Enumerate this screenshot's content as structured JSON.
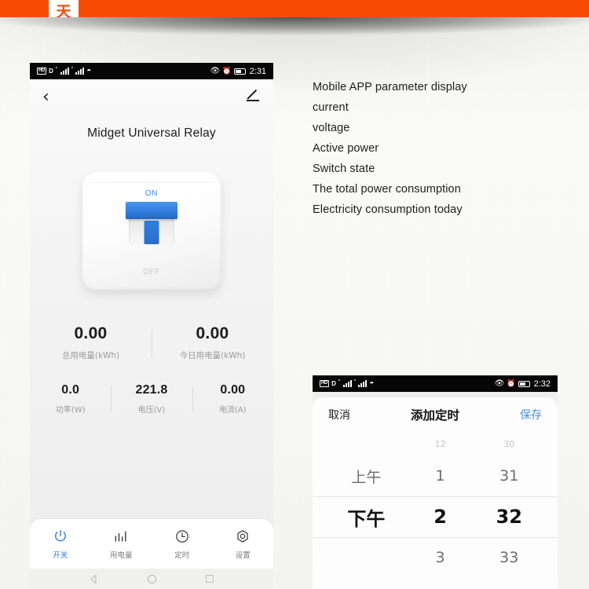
{
  "banner": {
    "logo_glyph": "天",
    "color": "#fa4b05"
  },
  "phone_one": {
    "status_bar": {
      "hd_label": "HD",
      "data_label": "D",
      "time": "2:31"
    },
    "nav": {
      "back_icon": "chevron-left-icon",
      "edit_icon": "pencil-icon"
    },
    "title": "Midget Universal Relay",
    "device": {
      "on_label": "ON",
      "off_label": "OFF",
      "switch_state": "on",
      "switch_color": "#2f7fe0"
    },
    "stats_primary": [
      {
        "value": "0.00",
        "label": "总用电量(kWh)"
      },
      {
        "value": "0.00",
        "label": "今日用电量(kWh)"
      }
    ],
    "stats_secondary": [
      {
        "value": "0.0",
        "label": "功率(W)"
      },
      {
        "value": "221.8",
        "label": "电压(V)"
      },
      {
        "value": "0.00",
        "label": "电流(A)"
      }
    ],
    "tabs": [
      {
        "label": "开关",
        "icon": "power-icon",
        "active": true
      },
      {
        "label": "用电量",
        "icon": "bar-chart-icon",
        "active": false
      },
      {
        "label": "定时",
        "icon": "clock-icon",
        "active": false
      },
      {
        "label": "设置",
        "icon": "hex-gear-icon",
        "active": false
      }
    ],
    "android_nav": [
      "back-triangle-icon",
      "home-circle-icon",
      "recents-square-icon"
    ],
    "active_color": "#2f7fe0"
  },
  "features": {
    "items": [
      "Mobile APP parameter display",
      "current",
      "voltage",
      "Active power",
      "Switch state",
      "The total power consumption",
      "Electricity consumption today"
    ]
  },
  "phone_two": {
    "status_bar": {
      "hd_label": "HD",
      "data_label": "D",
      "time": "2:32"
    },
    "nav": {
      "cancel": "取消",
      "title": "添加定时",
      "save": "保存",
      "save_color": "#4a90d9"
    },
    "picker": {
      "ampm": {
        "faint": "",
        "near": "上午",
        "selected": "下午",
        "far": ""
      },
      "hour": {
        "faint": "12",
        "near": "1",
        "selected": "2",
        "far": "3"
      },
      "minute": {
        "faint": "30",
        "near": "31",
        "selected": "32",
        "far": "33"
      }
    }
  }
}
